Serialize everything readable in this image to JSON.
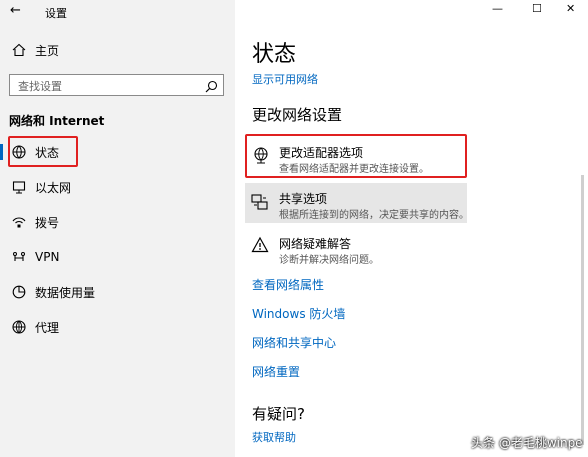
{
  "window": {
    "title": "设置",
    "controls": {
      "minimize": "—",
      "maximize": "☐",
      "close": "✕"
    }
  },
  "sidebar": {
    "home_label": "主页",
    "search_placeholder": "查找设置",
    "section_title": "网络和 Internet",
    "items": [
      {
        "label": "状态",
        "icon": "status-globe-icon",
        "selected": true
      },
      {
        "label": "以太网",
        "icon": "ethernet-icon"
      },
      {
        "label": "拨号",
        "icon": "dialup-icon"
      },
      {
        "label": "VPN",
        "icon": "vpn-icon"
      },
      {
        "label": "数据使用量",
        "icon": "data-usage-icon"
      },
      {
        "label": "代理",
        "icon": "proxy-globe-icon"
      }
    ]
  },
  "main": {
    "page_title": "状态",
    "show_networks_link": "显示可用网络",
    "change_settings_heading": "更改网络设置",
    "options": [
      {
        "title": "更改适配器选项",
        "desc": "查看网络适配器并更改连接设置。",
        "icon": "adapter-icon",
        "highlighted": true
      },
      {
        "title": "共享选项",
        "desc": "根据所连接到的网络，决定要共享的内容。",
        "icon": "sharing-icon",
        "hovered": true
      },
      {
        "title": "网络疑难解答",
        "desc": "诊断并解决网络问题。",
        "icon": "warning-icon"
      }
    ],
    "links": [
      "查看网络属性",
      "Windows 防火墙",
      "网络和共享中心",
      "网络重置"
    ],
    "question_heading": "有疑问?",
    "help_link": "获取帮助"
  },
  "watermark": "头条 @老毛桃winpe",
  "colors": {
    "accent": "#0067c0",
    "highlight": "#e02020",
    "sidebar_bg": "#f2f2f2",
    "hover_bg": "#e6e6e6"
  }
}
